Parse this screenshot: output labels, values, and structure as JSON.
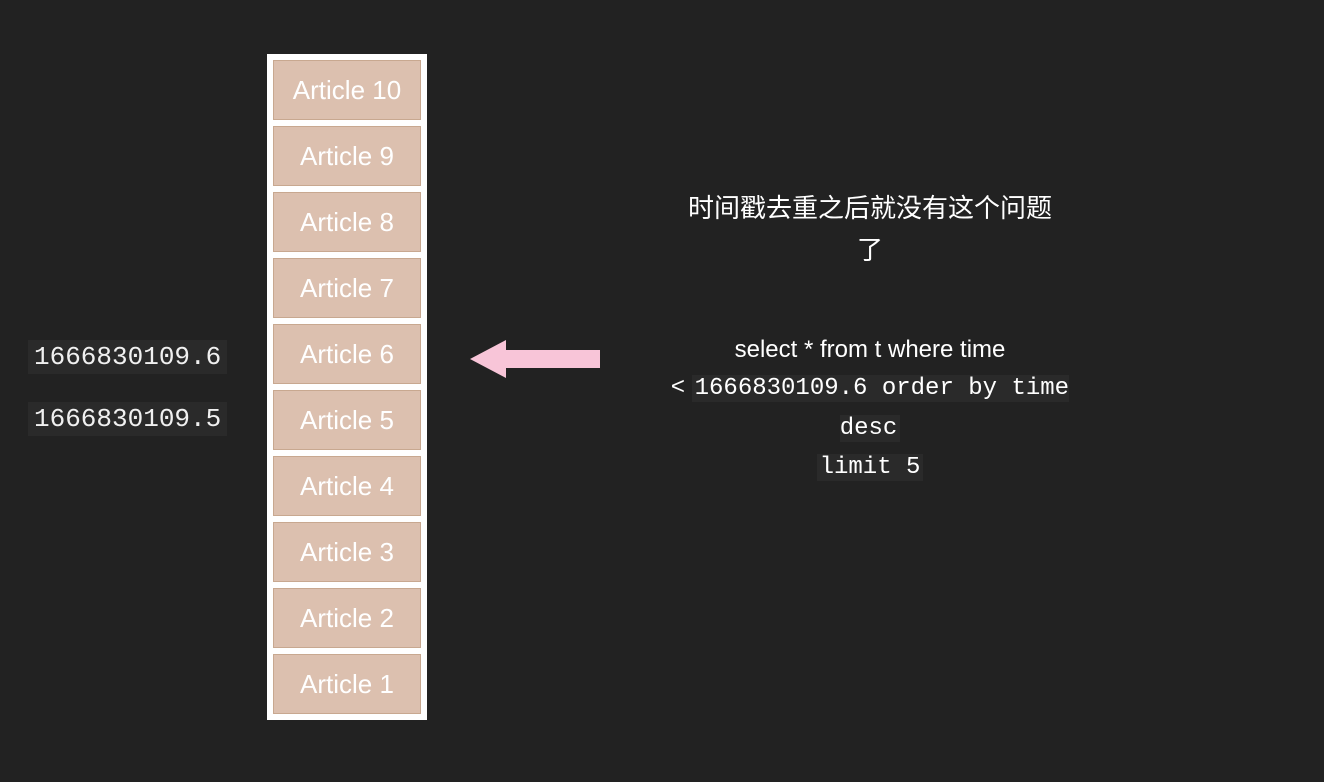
{
  "timestamps": [
    "1666830109.6",
    "1666830109.5"
  ],
  "articles": [
    "Article 10",
    "Article 9",
    "Article 8",
    "Article 7",
    "Article 6",
    "Article 5",
    "Article 4",
    "Article 3",
    "Article 2",
    "Article 1"
  ],
  "comment_line1": "时间戳去重之后就没有这个问题",
  "comment_line2": "了",
  "sql_part1": "select * from  t where time",
  "sql_lt": "<",
  "sql_mono1": "1666830109.6 order by time desc",
  "sql_mono2": "limit 5",
  "arrow_color": "#f8c5d8"
}
